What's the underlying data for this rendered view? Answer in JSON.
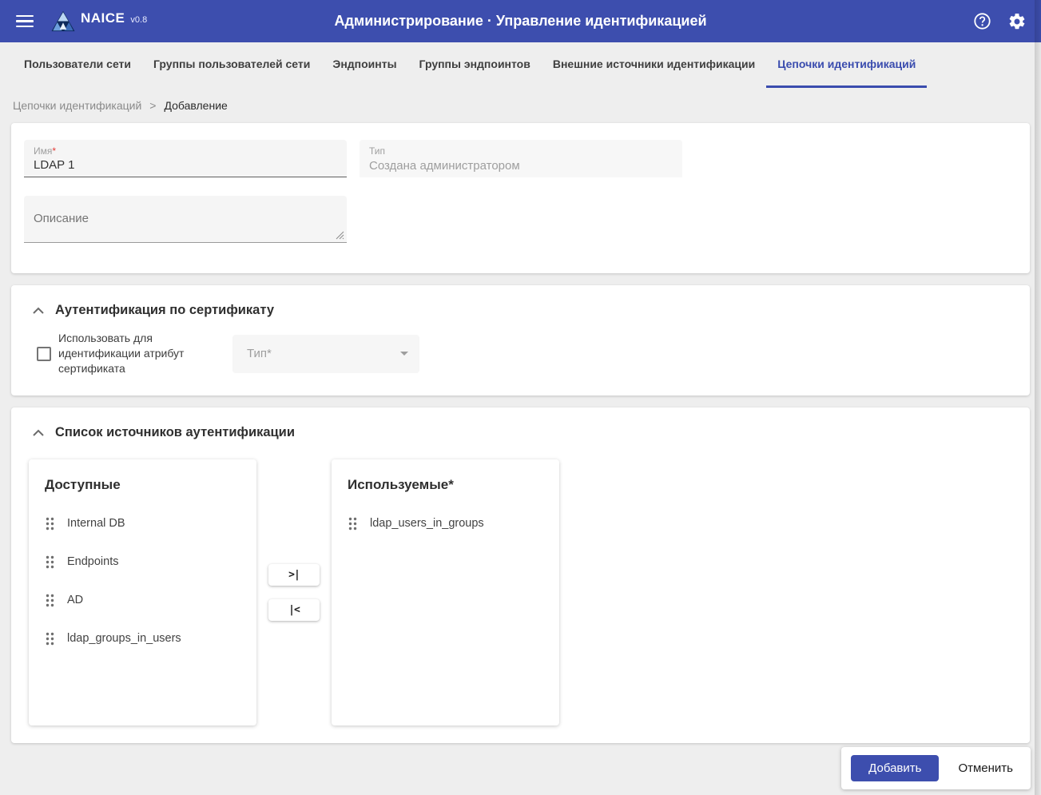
{
  "app": {
    "name": "NAICE",
    "version": "v0.8",
    "title": "Администрирование · Управление идентификацией"
  },
  "tabs": {
    "items": [
      {
        "label": "Пользователи сети",
        "active": false
      },
      {
        "label": "Группы пользователей сети",
        "active": false
      },
      {
        "label": "Эндпоинты",
        "active": false
      },
      {
        "label": "Группы эндпоинтов",
        "active": false
      },
      {
        "label": "Внешние источники идентификации",
        "active": false
      },
      {
        "label": "Цепочки идентификаций",
        "active": true
      }
    ]
  },
  "breadcrumb": {
    "parent": "Цепочки идентификаций",
    "separator": ">",
    "current": "Добавление"
  },
  "form": {
    "name": {
      "label": "Имя",
      "required_mark": "*",
      "value": "LDAP 1"
    },
    "type": {
      "label": "Тип",
      "value": "Создана администратором",
      "disabled": true
    },
    "description": {
      "placeholder": "Описание",
      "value": ""
    }
  },
  "certificate_section": {
    "title": "Аутентификация по сертификату",
    "use_attribute_checkbox": {
      "label": "Использовать для идентификации атрибут сертификата",
      "checked": false
    },
    "type_select": {
      "placeholder": "Тип*",
      "disabled": true
    }
  },
  "sources_section": {
    "title": "Список источников аутентификации",
    "available": {
      "title": "Доступные",
      "items": [
        "Internal DB",
        "Endpoints",
        "AD",
        "ldap_groups_in_users"
      ]
    },
    "used": {
      "title": "Используемые*",
      "items": [
        "ldap_users_in_groups"
      ]
    },
    "transfer": {
      "move_all_right_label": ">|",
      "move_all_left_label": "|<"
    }
  },
  "footer": {
    "submit_label": "Добавить",
    "cancel_label": "Отменить"
  },
  "colors": {
    "accent": "#3d4eae",
    "active_tab": "#3a4cae",
    "page_background": "#eeeeee",
    "required_mark": "#e53935"
  }
}
